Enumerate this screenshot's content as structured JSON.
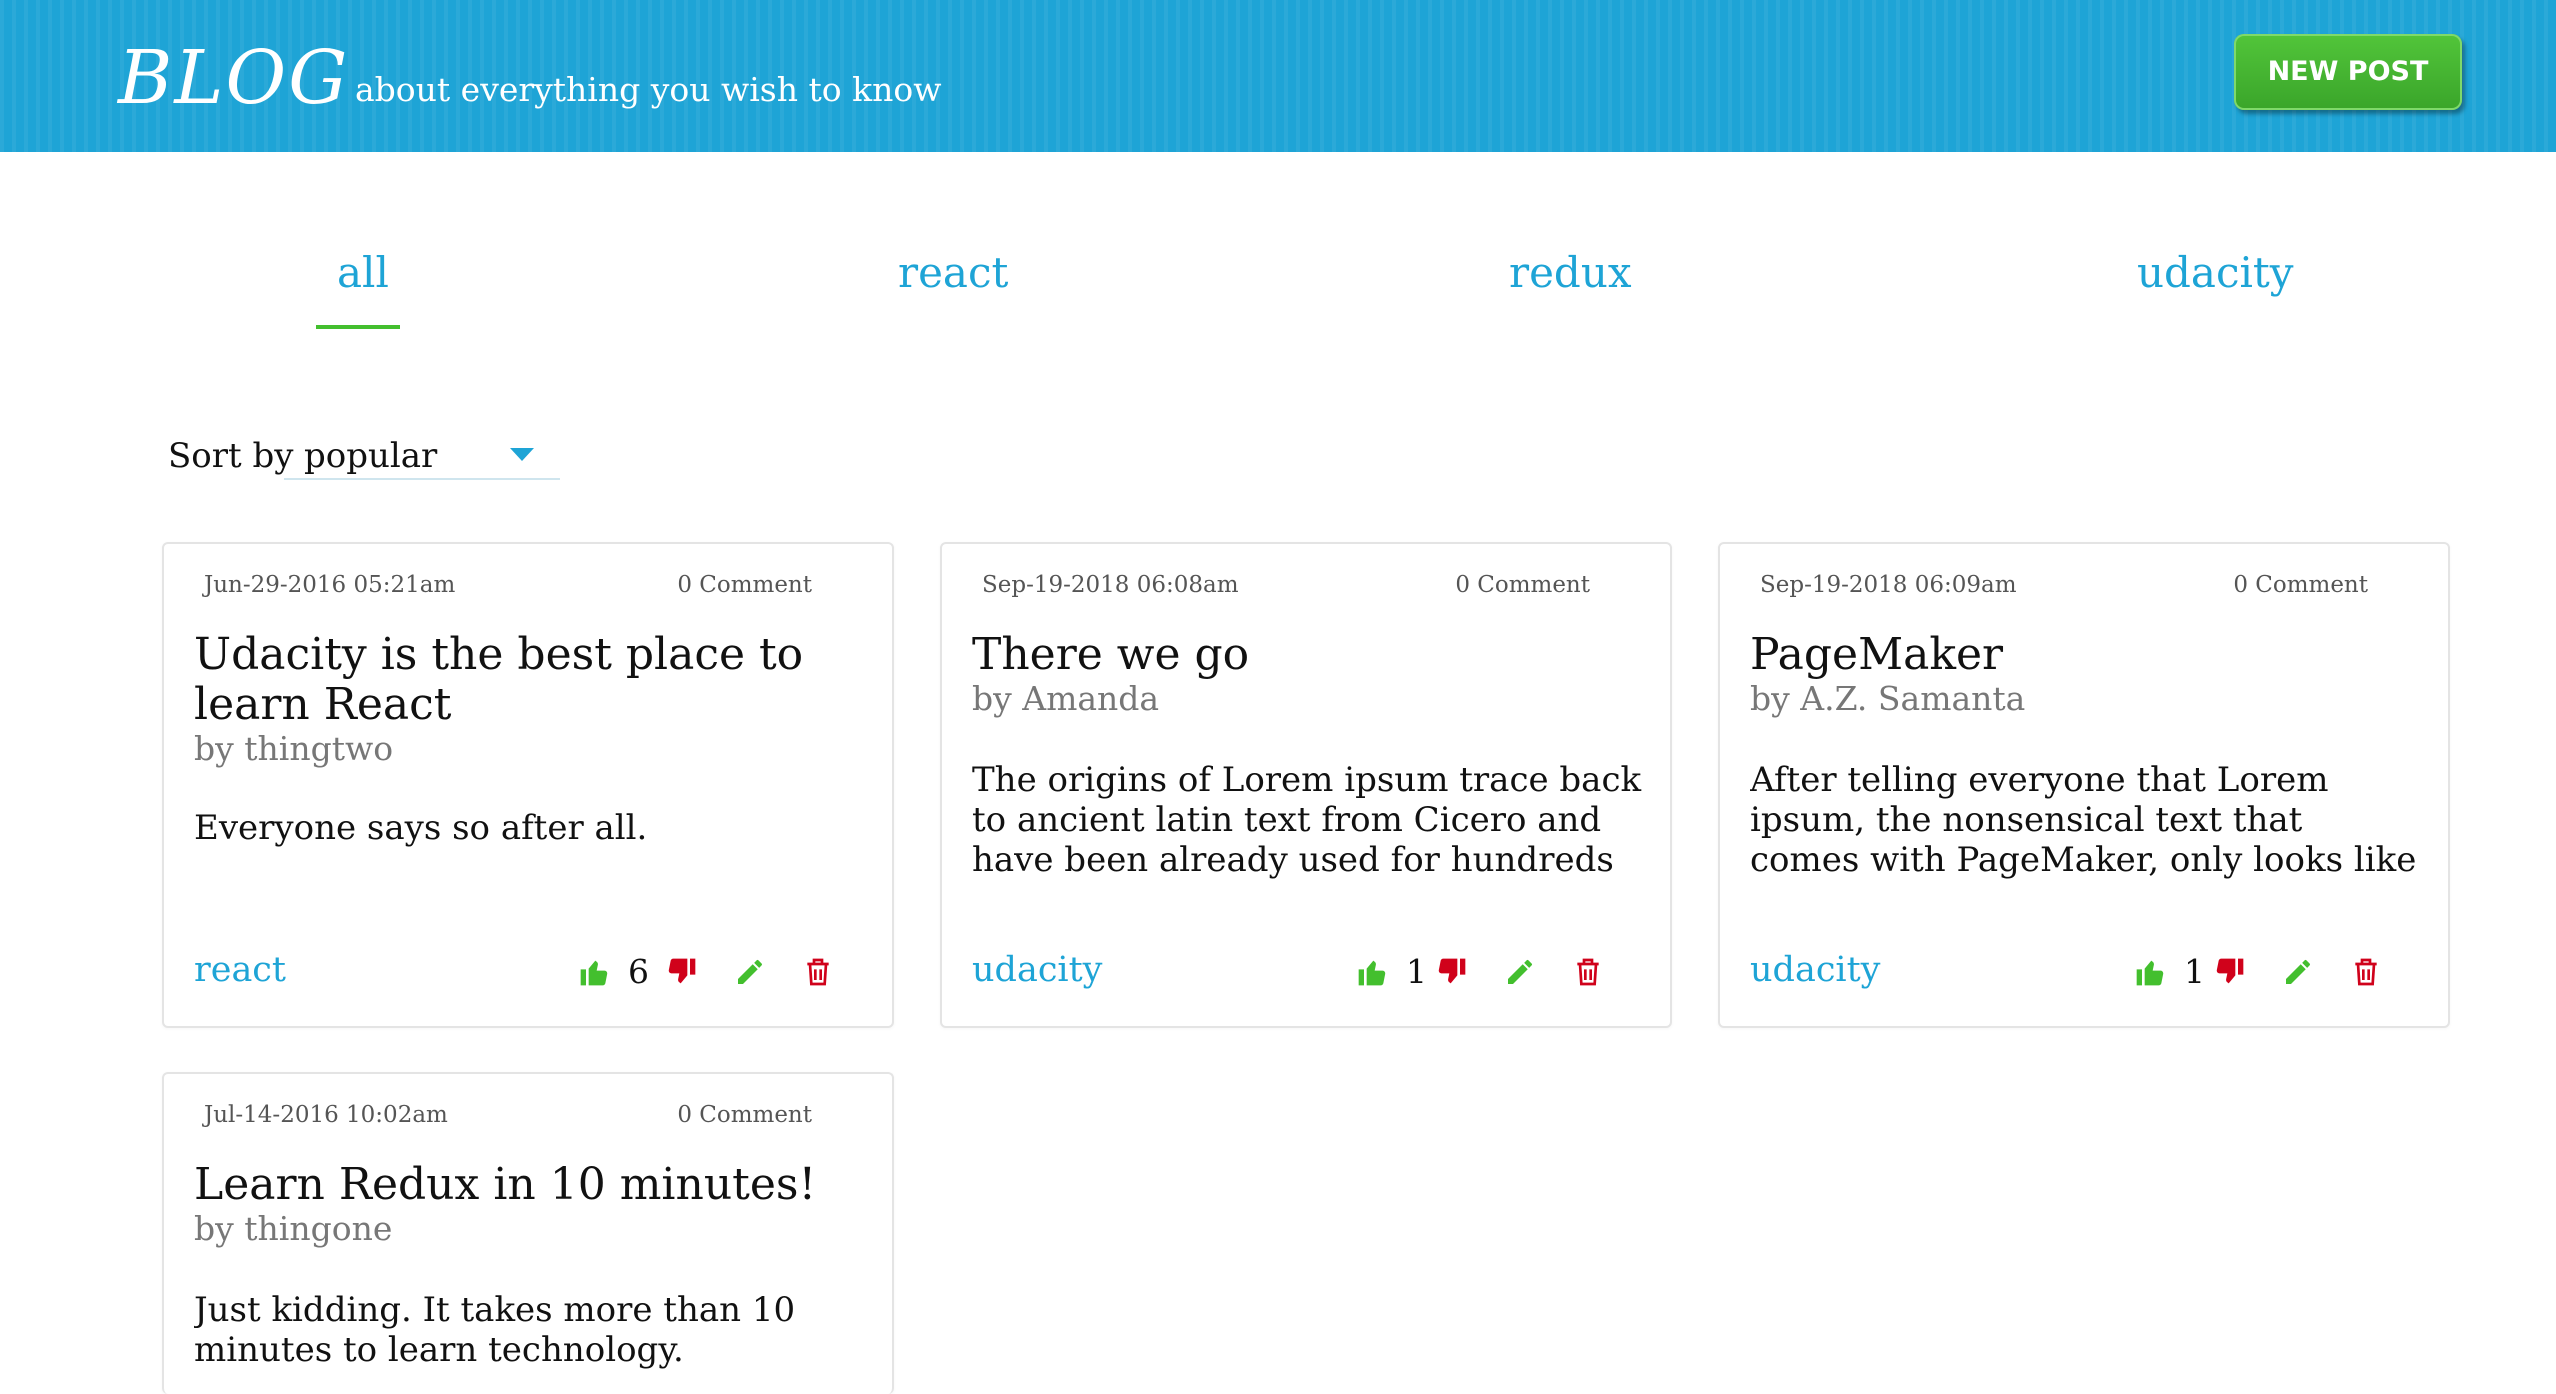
{
  "header": {
    "logo": "BLOG",
    "tagline": "about everything you wish to know",
    "new_post_label": "NEW POST"
  },
  "tabs": [
    {
      "label": "all",
      "active": true
    },
    {
      "label": "react",
      "active": false
    },
    {
      "label": "redux",
      "active": false
    },
    {
      "label": "udacity",
      "active": false
    }
  ],
  "sort": {
    "label": "Sort by",
    "selected": "popular"
  },
  "posts": [
    {
      "date": "Jun-29-2016 05:21am",
      "comments": "0 Comment",
      "title": "Udacity is the best place to learn React",
      "author": "by thingtwo",
      "body": "Everyone says so after all.",
      "category": "react",
      "votes": "6"
    },
    {
      "date": "Sep-19-2018 06:08am",
      "comments": "0 Comment",
      "title": "There we go",
      "author": "by Amanda",
      "body": "The origins of Lorem ipsum trace back to ancient latin text from Cicero and have been already used for hundreds of years by book",
      "category": "udacity",
      "votes": "1"
    },
    {
      "date": "Sep-19-2018 06:09am",
      "comments": "0 Comment",
      "title": "PageMaker",
      "author": "by A.Z. Samanta",
      "body": "After telling everyone that Lorem ipsum, the nonsensical text that comes with PageMaker, only looks like Latin but actually",
      "category": "udacity",
      "votes": "1"
    },
    {
      "date": "Jul-14-2016 10:02am",
      "comments": "0 Comment",
      "title": "Learn Redux in 10 minutes!",
      "author": "by thingone",
      "body": "Just kidding. It takes more than 10 minutes to learn technology.",
      "category": "",
      "votes": ""
    }
  ],
  "colors": {
    "header_bg": "#1ea4d6",
    "accent": "#1ea4d6",
    "button_green": "#43bf2e",
    "upvote": "#43bf2e",
    "downvote": "#d0021b",
    "edit": "#43bf2e",
    "delete": "#d0021b"
  },
  "icons": {
    "upvote": "thumbs-up-icon",
    "downvote": "thumbs-down-icon",
    "edit": "pencil-icon",
    "delete": "trash-icon",
    "sort": "caret-down-icon"
  }
}
